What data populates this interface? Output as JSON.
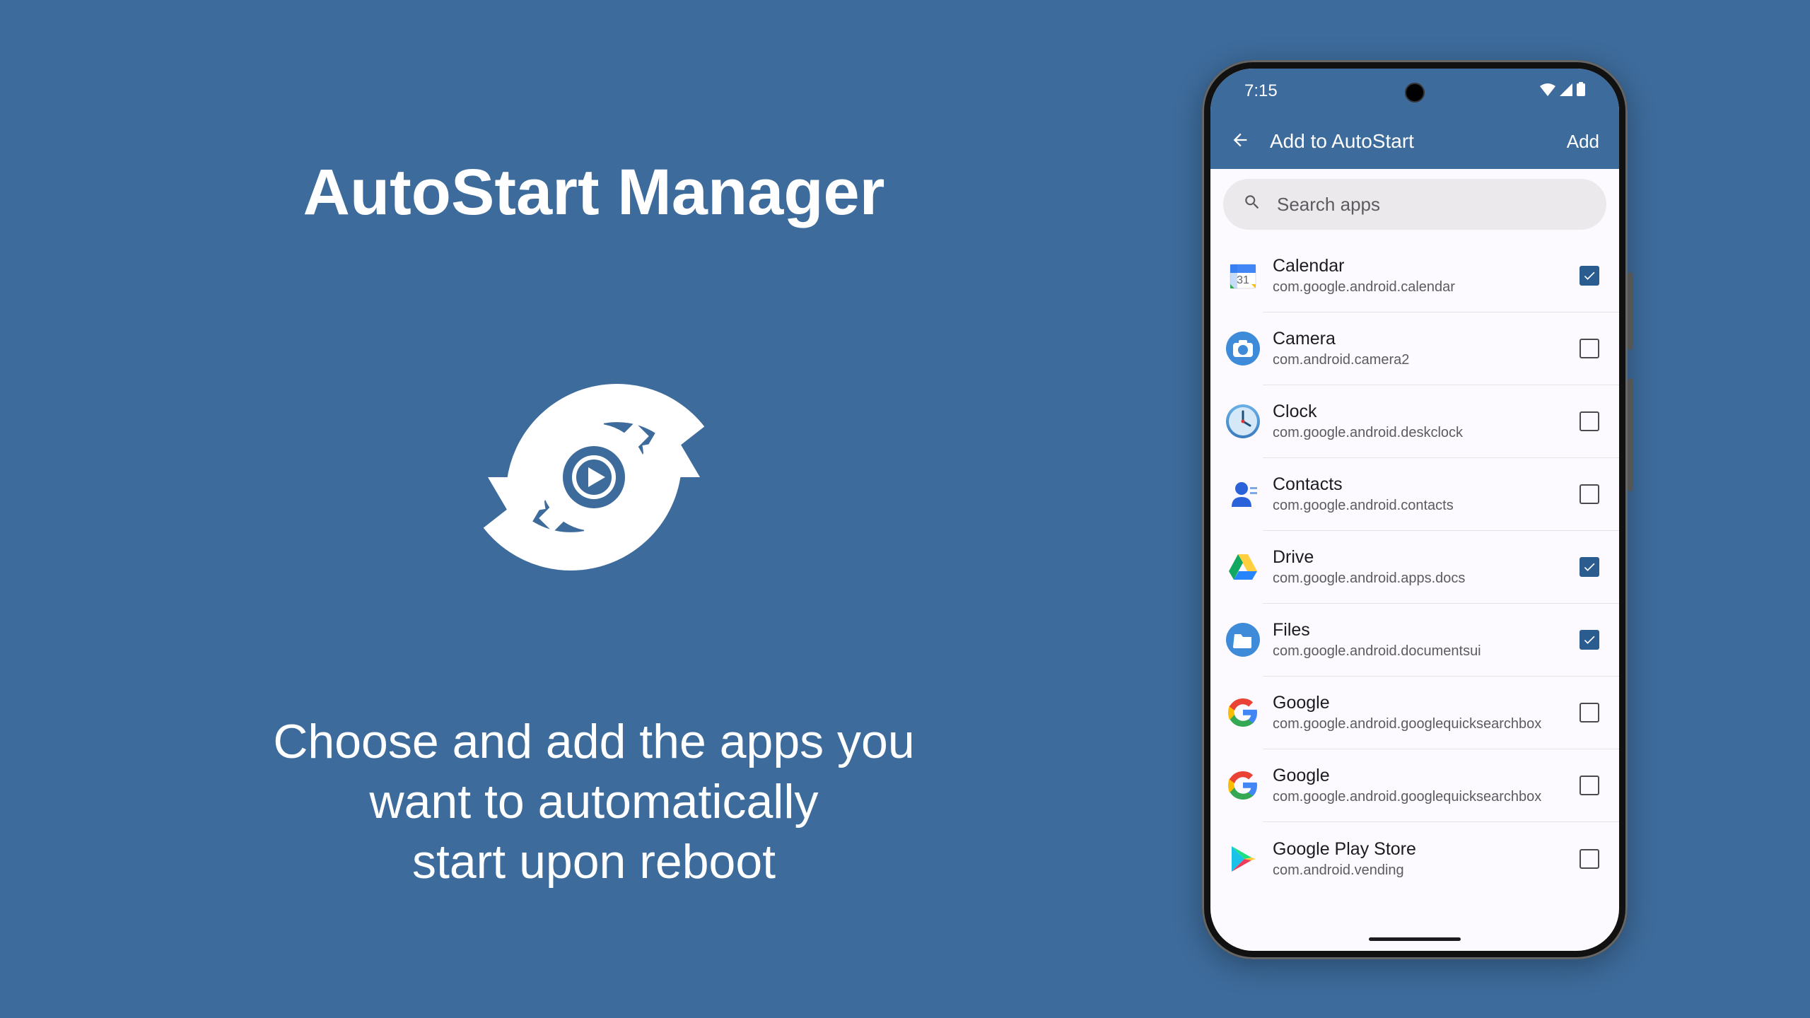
{
  "marketing": {
    "title": "AutoStart Manager",
    "subtitle_l1": "Choose and add the apps you",
    "subtitle_l2": "want to automatically",
    "subtitle_l3": "start upon reboot"
  },
  "statusbar": {
    "time": "7:15"
  },
  "appbar": {
    "title": "Add to AutoStart",
    "action": "Add"
  },
  "search": {
    "placeholder": "Search apps"
  },
  "apps": [
    {
      "name": "Calendar",
      "pkg": "com.google.android.calendar",
      "checked": true,
      "icon": "calendar"
    },
    {
      "name": "Camera",
      "pkg": "com.android.camera2",
      "checked": false,
      "icon": "camera"
    },
    {
      "name": "Clock",
      "pkg": "com.google.android.deskclock",
      "checked": false,
      "icon": "clock"
    },
    {
      "name": "Contacts",
      "pkg": "com.google.android.contacts",
      "checked": false,
      "icon": "contacts"
    },
    {
      "name": "Drive",
      "pkg": "com.google.android.apps.docs",
      "checked": true,
      "icon": "drive"
    },
    {
      "name": "Files",
      "pkg": "com.google.android.documentsui",
      "checked": true,
      "icon": "files"
    },
    {
      "name": "Google",
      "pkg": "com.google.android.googlequicksearchbox",
      "checked": false,
      "icon": "google"
    },
    {
      "name": "Google",
      "pkg": "com.google.android.googlequicksearchbox",
      "checked": false,
      "icon": "google"
    },
    {
      "name": "Google Play Store",
      "pkg": "com.android.vending",
      "checked": false,
      "icon": "play"
    }
  ]
}
